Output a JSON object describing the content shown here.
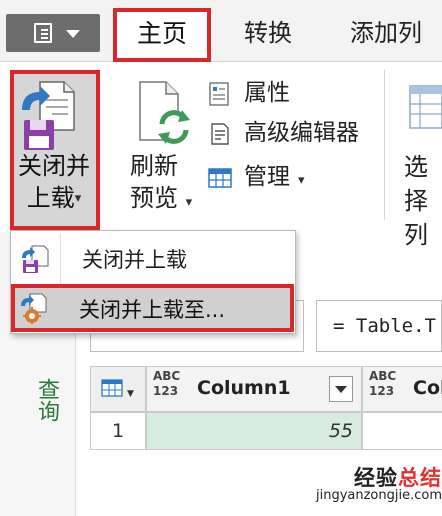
{
  "tabs": {
    "home": "主页",
    "transform": "转换",
    "add_column": "添加列"
  },
  "ribbon": {
    "close_load": {
      "line1": "关闭并",
      "line2": "上载"
    },
    "refresh_preview": {
      "line1": "刷新",
      "line2": "预览"
    },
    "properties": "属性",
    "advanced_editor": "高级编辑器",
    "manage": "管理",
    "select_columns": {
      "line1": "选择",
      "line2": "列"
    }
  },
  "dropdown": {
    "items": [
      {
        "label": "关闭并上载"
      },
      {
        "label": "关闭并上载至..."
      }
    ]
  },
  "formula_bar": {
    "text": "= Table.T"
  },
  "queries_pane": {
    "label": "查询"
  },
  "grid": {
    "type_label_top": "ABC",
    "type_label_bottom": "123",
    "columns": [
      "Column1",
      "Col"
    ],
    "rows": [
      {
        "index": "1",
        "col1": "55"
      }
    ]
  },
  "watermark": {
    "brand_part1": "经验",
    "brand_part2": "总结",
    "url": "jingyanzongjie.com"
  },
  "colors": {
    "highlight_border": "#d8282c",
    "selected_cell": "#d7ece0",
    "queries_label": "#2c7a3a"
  }
}
